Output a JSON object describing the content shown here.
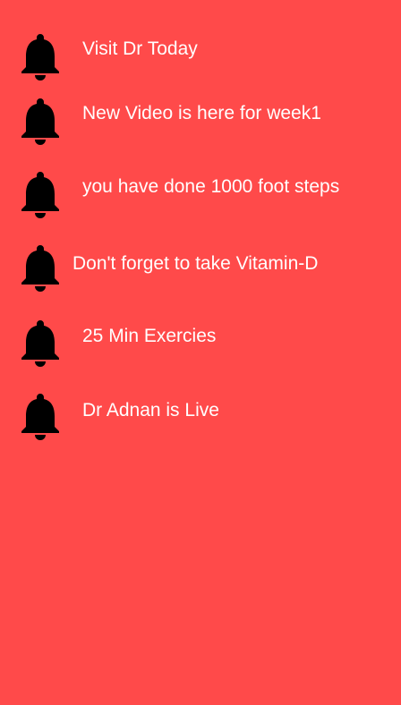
{
  "colors": {
    "background": "#ff4a4a",
    "text": "#ffffff",
    "icon": "#000000"
  },
  "notifications": [
    {
      "icon": "bell-icon",
      "text": "Visit Dr Today"
    },
    {
      "icon": "bell-icon",
      "text": "New Video is here for week1"
    },
    {
      "icon": "bell-icon",
      "text": "you have done 1000 foot steps"
    },
    {
      "icon": "bell-icon",
      "text": "Don't forget to take Vitamin-D"
    },
    {
      "icon": "bell-icon",
      "text": "25 Min Exercies"
    },
    {
      "icon": "bell-icon",
      "text": "Dr Adnan is Live"
    }
  ]
}
